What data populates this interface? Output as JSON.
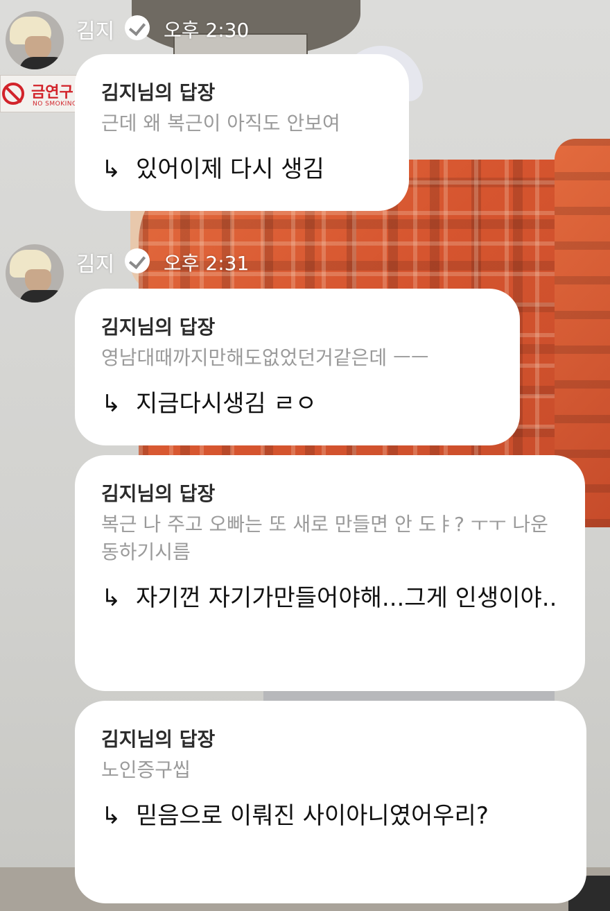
{
  "sender": {
    "name": "김지",
    "avatar_icon": "avatar-icon",
    "verified_icon": "verified-badge-icon"
  },
  "groups": [
    {
      "time": "오후 2:30",
      "messages": [
        {
          "title": "김지님의 답장",
          "quote": "근데 왜 복근이 아직도 안보여",
          "arrow": "↳",
          "reply": "있어이제 다시 생김"
        }
      ]
    },
    {
      "time": "오후 2:31",
      "messages": [
        {
          "title": "김지님의 답장",
          "quote": "영남대때까지만해도없었던거같은데 ㅡㅡ",
          "arrow": "↳",
          "reply": "지금다시생김 ㄹㅇ"
        },
        {
          "title": "김지님의 답장",
          "quote": "복근 나 주고 오빠는 또 새로 만들면 안 도ㅑ? ㅜㅜ 나운동하기시름",
          "arrow": "↳",
          "reply": "자기껀 자기가만들어야해...그게 인생이야.."
        },
        {
          "title": "김지님의 답장",
          "quote": "노인증구씹",
          "arrow": "↳",
          "reply": "믿음으로 이뤄진 사이아니였어우리?"
        }
      ]
    }
  ],
  "background": {
    "sign_text": "금연구",
    "sign_sub": "NO SMOKING"
  }
}
